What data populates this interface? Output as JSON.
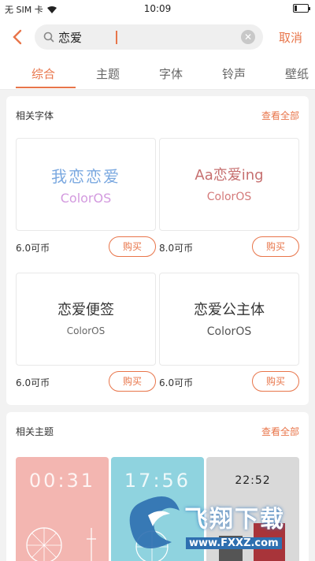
{
  "status": {
    "carrier": "无 SIM 卡",
    "time": "10:09",
    "battery_level": 0.15
  },
  "search": {
    "query": "恋爱",
    "cancel_label": "取消"
  },
  "tabs": [
    {
      "label": "综合"
    },
    {
      "label": "主题"
    },
    {
      "label": "字体"
    },
    {
      "label": "铃声"
    },
    {
      "label": "壁纸"
    }
  ],
  "fonts_section": {
    "title": "相关字体",
    "more": "查看全部",
    "items": [
      {
        "line1": "我恋恋爱",
        "line2": "ColorOS",
        "price": "6.0可币",
        "buy": "购买"
      },
      {
        "line1": "Aa恋爱ing",
        "line2": "ColorOS",
        "price": "8.0可币",
        "buy": "购买"
      },
      {
        "line1": "恋爱便签",
        "line2": "ColorOS",
        "price": "6.0可币",
        "buy": "购买"
      },
      {
        "line1": "恋爱公主体",
        "line2": "ColorOS",
        "price": "6.0可币",
        "buy": "购买"
      }
    ]
  },
  "themes_section": {
    "title": "相关主题",
    "more": "查看全部",
    "items": [
      {
        "time": "00:31",
        "color": "#f3b6b1"
      },
      {
        "time": "17:56",
        "color": "#8fd3df"
      },
      {
        "time": "22:52",
        "color": "#d9d9d9"
      }
    ]
  },
  "watermark": {
    "title": "飞翔下载",
    "url": "www.FXXZ.com"
  },
  "colors": {
    "accent": "#e8754a"
  }
}
